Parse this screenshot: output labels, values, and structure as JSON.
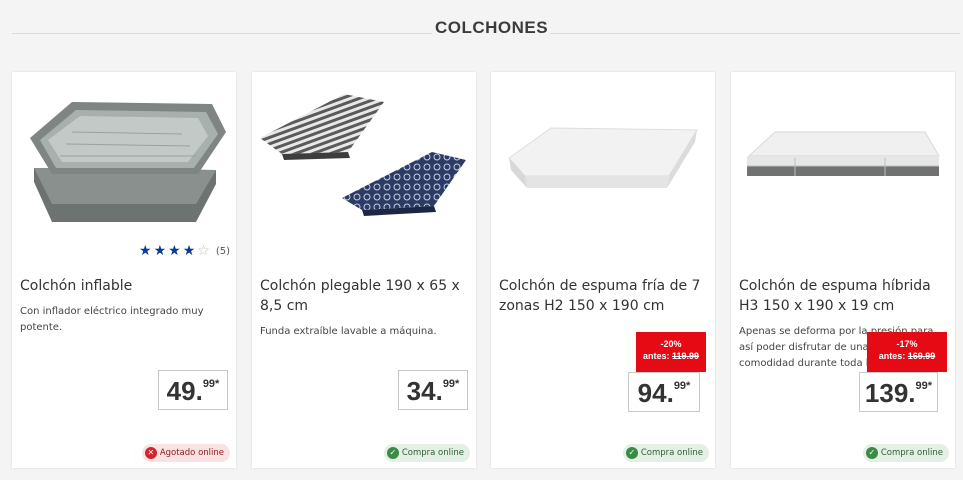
{
  "section": {
    "title": "COLCHONES"
  },
  "products": [
    {
      "title": "Colchón inflable",
      "description": "Con inflador eléctrico integrado muy potente.",
      "rating": {
        "stars": 4,
        "max": 5,
        "count": "(5)"
      },
      "price": {
        "integer": "49.",
        "cents": "99*"
      },
      "promo": null,
      "availability": {
        "label": "Agotado online",
        "status": "unavailable",
        "icon": "x-circle-icon"
      }
    },
    {
      "title": "Colchón plegable 190 x 65 x 8,5 cm",
      "description": "Funda extraíble lavable a máquina.",
      "rating": null,
      "price": {
        "integer": "34.",
        "cents": "99*"
      },
      "promo": null,
      "availability": {
        "label": "Compra online",
        "status": "available",
        "icon": "check-circle-icon"
      }
    },
    {
      "title": "Colchón de espuma fría de 7 zonas H2 150 x 190 cm",
      "description": "",
      "rating": null,
      "price": {
        "integer": "94.",
        "cents": "99*"
      },
      "promo": {
        "discount": "-20%",
        "before_label": "antes:",
        "before_price": "119.99"
      },
      "availability": {
        "label": "Compra online",
        "status": "available",
        "icon": "check-circle-icon"
      }
    },
    {
      "title": "Colchón de espuma híbrida H3 150 x 190 x 19 cm",
      "description": "Apenas se deforma por la presión para así poder disfrutar de una gran comodidad durante toda la noche.",
      "rating": null,
      "price": {
        "integer": "139.",
        "cents": "99*"
      },
      "promo": {
        "discount": "-17%",
        "before_label": "antes:",
        "before_price": "169.99"
      },
      "availability": {
        "label": "Compra online",
        "status": "available",
        "icon": "check-circle-icon"
      }
    }
  ],
  "colors": {
    "promo_red": "#e60a14",
    "star_blue": "#0a3d8f",
    "available_green": "#3a8c45",
    "unavailable_red": "#d6222b"
  }
}
